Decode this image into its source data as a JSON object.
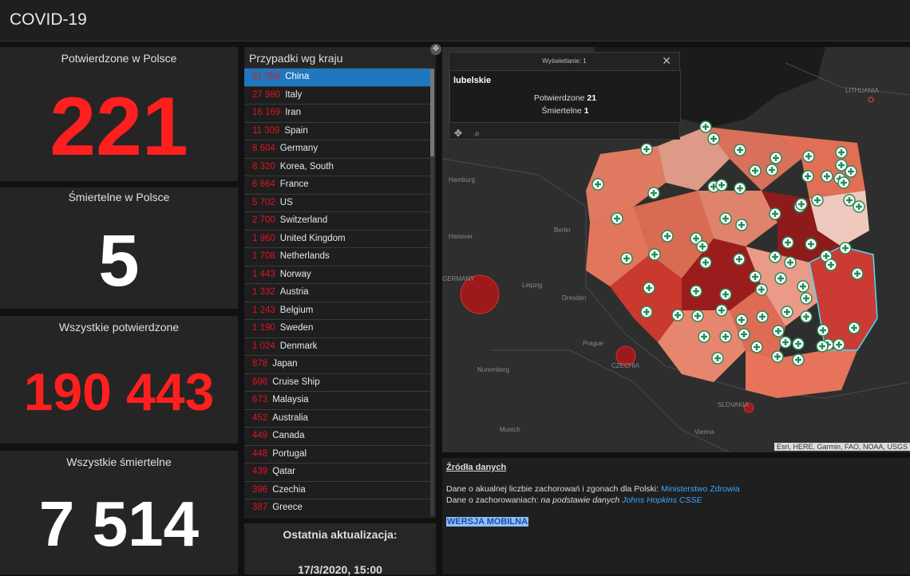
{
  "header": {
    "title": "COVID-19"
  },
  "stats": {
    "poland_confirmed": {
      "label": "Potwierdzone w Polsce",
      "value": "221"
    },
    "poland_deaths": {
      "label": "Śmiertelne w Polsce",
      "value": "5"
    },
    "global_confirmed": {
      "label": "Wszystkie potwierdzone",
      "value": "190 443"
    },
    "global_deaths": {
      "label": "Wszystkie śmiertelne",
      "value": "7 514"
    }
  },
  "countries": {
    "title": "Przypadki wg kraju",
    "items": [
      {
        "count": "81 058",
        "name": "China"
      },
      {
        "count": "27 980",
        "name": "Italy"
      },
      {
        "count": "16 169",
        "name": "Iran"
      },
      {
        "count": "11 309",
        "name": "Spain"
      },
      {
        "count": "8 604",
        "name": "Germany"
      },
      {
        "count": "8 320",
        "name": "Korea, South"
      },
      {
        "count": "6 664",
        "name": "France"
      },
      {
        "count": "5 702",
        "name": "US"
      },
      {
        "count": "2 700",
        "name": "Switzerland"
      },
      {
        "count": "1 960",
        "name": "United Kingdom"
      },
      {
        "count": "1 708",
        "name": "Netherlands"
      },
      {
        "count": "1 443",
        "name": "Norway"
      },
      {
        "count": "1 332",
        "name": "Austria"
      },
      {
        "count": "1 243",
        "name": "Belgium"
      },
      {
        "count": "1 190",
        "name": "Sweden"
      },
      {
        "count": "1 024",
        "name": "Denmark"
      },
      {
        "count": "878",
        "name": "Japan"
      },
      {
        "count": "696",
        "name": "Cruise Ship"
      },
      {
        "count": "673",
        "name": "Malaysia"
      },
      {
        "count": "452",
        "name": "Australia"
      },
      {
        "count": "449",
        "name": "Canada"
      },
      {
        "count": "448",
        "name": "Portugal"
      },
      {
        "count": "439",
        "name": "Qatar"
      },
      {
        "count": "396",
        "name": "Czechia"
      },
      {
        "count": "387",
        "name": "Greece"
      }
    ]
  },
  "update": {
    "label": "Ostatnia aktualizacja:",
    "value": "17/3/2020, 15:00"
  },
  "map": {
    "popup": {
      "header": "Wyświetlanie: 1",
      "region": "lubelskie",
      "confirmed_label": "Potwierdzone",
      "confirmed_value": "21",
      "deaths_label": "Śmiertelne",
      "deaths_value": "1"
    },
    "attribution": "Esri, HERE, Garmin, FAO, NOAA, USGS",
    "labels": {
      "lithuania": "LITHUANIA",
      "germany": "GERMANY",
      "czechia": "CZECHIA",
      "slovakia": "SLOVAKIA",
      "hamburg": "Hamburg",
      "hanover": "Hanover",
      "berlin": "Berlin",
      "leipzig": "Leipzig",
      "dresden": "Dresden",
      "prague": "Prague",
      "nuremberg": "Nuremberg",
      "munich": "Munich",
      "vienna": "Vienna"
    }
  },
  "sources": {
    "title": "Źródła danych",
    "line1_text": "Dane o akualnej liczbie zachorowań i zgonach dla Polski:",
    "line1_link": "Ministerstwo Zdrowia",
    "line2_text": "Dane o zachorowaniach:",
    "line2_italic": "na podstawie danych",
    "line2_link": "Johns Hopkins CSSE",
    "mobile": "WERSJA MOBILNA"
  }
}
